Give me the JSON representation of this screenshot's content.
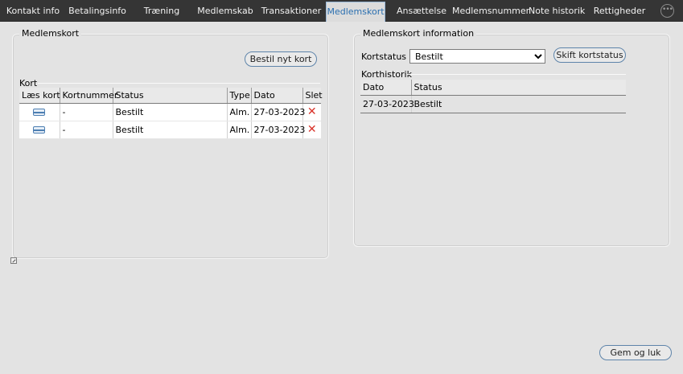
{
  "tabs": [
    {
      "label": "Kontakt info",
      "active": false
    },
    {
      "label": "Betalingsinfo",
      "active": false
    },
    {
      "label": "Træning",
      "active": false
    },
    {
      "label": "Medlemskab",
      "active": false
    },
    {
      "label": "Transaktioner",
      "active": false
    },
    {
      "label": "Medlemskort",
      "active": true
    },
    {
      "label": "Ansættelse",
      "active": false
    },
    {
      "label": "Medlemsnummer",
      "active": false
    },
    {
      "label": "Note historik",
      "active": false
    },
    {
      "label": "Rettigheder",
      "active": false
    }
  ],
  "more_icon": "ellipsis-circle-icon",
  "left_group": {
    "title": "Medlemskort",
    "order_button": "Bestil nyt kort",
    "kort_label": "Kort",
    "table": {
      "headers": [
        "Læs kort",
        "Kortnummer",
        "Status",
        "Type",
        "Dato",
        "Slet"
      ],
      "rows": [
        {
          "read_icon": "card-reader-icon",
          "number": "-",
          "status": "Bestilt",
          "type": "Alm.",
          "date": "27-03-2023",
          "delete_icon": "delete-x-icon"
        },
        {
          "read_icon": "card-reader-icon",
          "number": "-",
          "status": "Bestilt",
          "type": "Alm.",
          "date": "27-03-2023",
          "delete_icon": "delete-x-icon"
        }
      ]
    }
  },
  "right_group": {
    "title": "Medlemskort information",
    "kortstatus_label": "Kortstatus",
    "kortstatus_value": "Bestilt",
    "change_button": "Skift kortstatus",
    "history_label": "Korthistorik",
    "history": {
      "headers": [
        "Dato",
        "Status"
      ],
      "rows": [
        {
          "date": "27-03-2023",
          "status": "Bestilt"
        }
      ]
    }
  },
  "save_close_button": "Gem og luk",
  "colors": {
    "tabbar": "#353535",
    "accent": "#2a6fb0",
    "delete": "#d9342b",
    "button_border": "#5e84aa"
  }
}
